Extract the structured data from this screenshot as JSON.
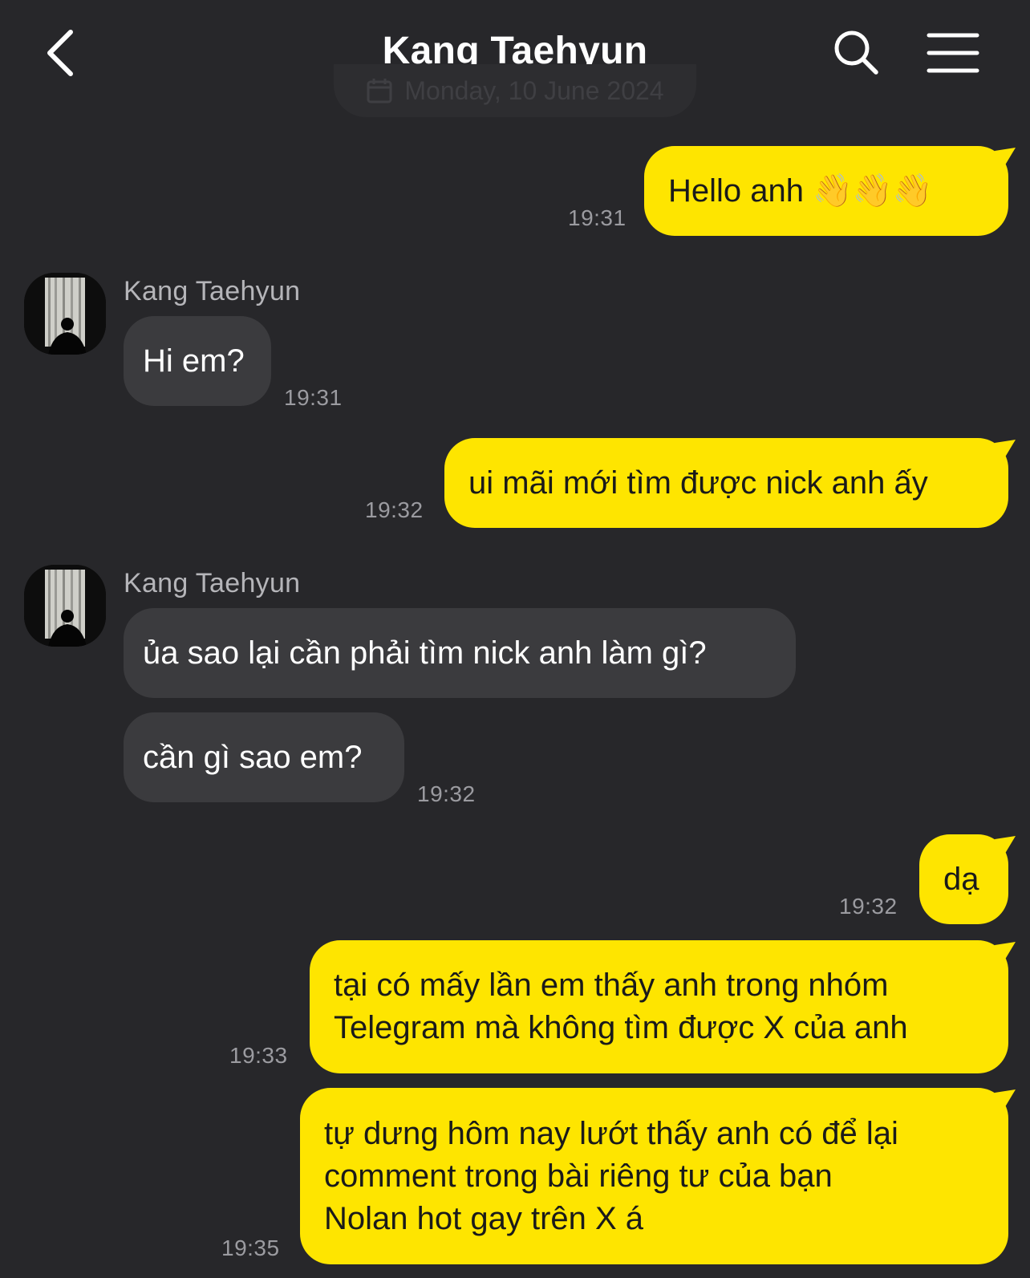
{
  "header": {
    "title": "Kang Taehyun",
    "back_icon": "chevron-left-icon",
    "search_icon": "search-icon",
    "menu_icon": "hamburger-menu-icon"
  },
  "date_divider": "Monday, 10 June 2024",
  "colors": {
    "background": "#27272a",
    "my_bubble": "#fee500",
    "their_bubble": "#3b3b3e"
  },
  "messages": [
    {
      "from": "me",
      "text": "Hello anh 👋👋👋",
      "time": "19:31"
    },
    {
      "from": "them",
      "sender": "Kang Taehyun",
      "text": "Hi em?",
      "time": "19:31"
    },
    {
      "from": "me",
      "text": "ui mãi mới tìm được nick anh ấy",
      "time": "19:32"
    },
    {
      "from": "them",
      "sender": "Kang Taehyun",
      "text": "ủa sao lại cần phải tìm nick anh làm gì?",
      "time": ""
    },
    {
      "from": "them",
      "text": "cần gì sao em?",
      "time": "19:32"
    },
    {
      "from": "me",
      "text": "dạ",
      "time": "19:32"
    },
    {
      "from": "me",
      "lines": [
        "tại có mấy lần em thấy anh trong nhóm",
        "Telegram mà không tìm được X của anh"
      ],
      "time": "19:33"
    },
    {
      "from": "me",
      "lines": [
        "tự dưng hôm nay lướt thấy anh có để lại",
        "comment trong bài riêng tư của bạn",
        "Nolan hot gay trên X á"
      ],
      "time": "19:35"
    }
  ]
}
